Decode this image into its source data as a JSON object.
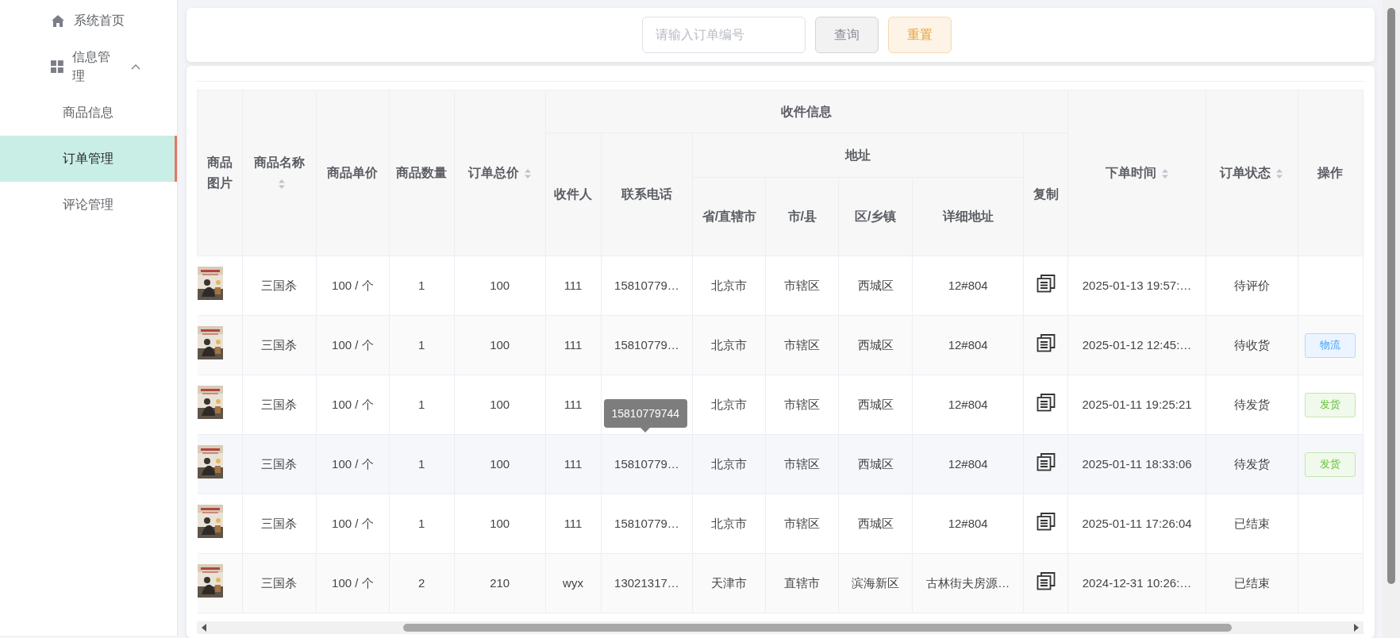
{
  "sidebar": {
    "items": [
      {
        "label": "系统首页",
        "selected": false
      },
      {
        "label": "信息管理",
        "expanded": true,
        "children": [
          {
            "label": "商品信息",
            "selected": false
          },
          {
            "label": "订单管理",
            "selected": true
          },
          {
            "label": "评论管理",
            "selected": false
          }
        ]
      }
    ]
  },
  "search": {
    "placeholder": "请输入订单编号",
    "buttons": [
      {
        "label": "查询",
        "kind": "default"
      },
      {
        "label": "重置",
        "kind": "warning"
      }
    ]
  },
  "table": {
    "columns": [
      {
        "label": "商品图片"
      },
      {
        "label": "商品名称",
        "sortable": true
      },
      {
        "label": "商品单价"
      },
      {
        "label": "商品数量"
      },
      {
        "label": "订单总价",
        "sortable": true
      },
      {
        "label": "收件信息",
        "colspan": 7,
        "children": [
          {
            "label": "收件人"
          },
          {
            "label": "联系电话"
          },
          {
            "label": "地址",
            "colspan": 4,
            "children": [
              {
                "label": "省/直辖市"
              },
              {
                "label": "市/县"
              },
              {
                "label": "区/乡镇"
              },
              {
                "label": "详细地址"
              }
            ]
          },
          {
            "label": "复制"
          }
        ]
      },
      {
        "label": "下单时间",
        "sortable": true
      },
      {
        "label": "订单状态",
        "sortable": true
      },
      {
        "label": "操作"
      }
    ],
    "rows": [
      {
        "cells": [
          {
            "kind": "picture"
          },
          {
            "kind": "text",
            "text": "三国杀"
          },
          {
            "kind": "text",
            "text": "100 / 个"
          },
          {
            "kind": "text",
            "text": "1"
          },
          {
            "kind": "text",
            "text": "100"
          },
          {
            "kind": "text",
            "text": "111"
          },
          {
            "kind": "text",
            "text": "15810779…"
          },
          {
            "kind": "text",
            "text": "北京市"
          },
          {
            "kind": "text",
            "text": "市辖区"
          },
          {
            "kind": "text",
            "text": "西城区"
          },
          {
            "kind": "text",
            "text": "12#804"
          },
          {
            "kind": "copy"
          },
          {
            "kind": "text",
            "text": "2025-01-13 19:57:…"
          },
          {
            "kind": "text",
            "text": "待评价"
          }
        ]
      },
      {
        "cells": [
          {
            "kind": "picture"
          },
          {
            "kind": "text",
            "text": "三国杀"
          },
          {
            "kind": "text",
            "text": "100 / 个"
          },
          {
            "kind": "text",
            "text": "1"
          },
          {
            "kind": "text",
            "text": "100"
          },
          {
            "kind": "text",
            "text": "111"
          },
          {
            "kind": "text",
            "text": "15810779…"
          },
          {
            "kind": "text",
            "text": "北京市"
          },
          {
            "kind": "text",
            "text": "市辖区"
          },
          {
            "kind": "text",
            "text": "西城区"
          },
          {
            "kind": "text",
            "text": "12#804"
          },
          {
            "kind": "copy"
          },
          {
            "kind": "text",
            "text": "2025-01-12 12:45:…"
          },
          {
            "kind": "text",
            "text": "待收货"
          },
          {
            "kind": "primary",
            "label": "物流"
          }
        ]
      },
      {
        "cells": [
          {
            "kind": "picture"
          },
          {
            "kind": "text",
            "text": "三国杀"
          },
          {
            "kind": "text",
            "text": "100 / 个"
          },
          {
            "kind": "text",
            "text": "1"
          },
          {
            "kind": "text",
            "text": "100"
          },
          {
            "kind": "text",
            "text": "111"
          },
          {
            "kind": "tooltip",
            "tooltip": "15810779744"
          },
          {
            "kind": "text",
            "text": "北京市"
          },
          {
            "kind": "text",
            "text": "市辖区"
          },
          {
            "kind": "text",
            "text": "西城区"
          },
          {
            "kind": "text",
            "text": "12#804"
          },
          {
            "kind": "copy"
          },
          {
            "kind": "text",
            "text": "2025-01-11 19:25:21"
          },
          {
            "kind": "text",
            "text": "待发货"
          },
          {
            "kind": "success",
            "label": "发货"
          }
        ]
      },
      {
        "cells": [
          {
            "kind": "picture"
          },
          {
            "kind": "text",
            "text": "三国杀"
          },
          {
            "kind": "text",
            "text": "100 / 个"
          },
          {
            "kind": "text",
            "text": "1"
          },
          {
            "kind": "text",
            "text": "100"
          },
          {
            "kind": "text",
            "text": "111"
          },
          {
            "kind": "text",
            "text": "15810779…"
          },
          {
            "kind": "text",
            "text": "北京市"
          },
          {
            "kind": "text",
            "text": "市辖区"
          },
          {
            "kind": "text",
            "text": "西城区"
          },
          {
            "kind": "text",
            "text": "12#804"
          },
          {
            "kind": "copy"
          },
          {
            "kind": "text",
            "text": "2025-01-11 18:33:06"
          },
          {
            "kind": "text",
            "text": "待发货"
          },
          {
            "kind": "success",
            "label": "发货"
          }
        ]
      },
      {
        "cells": [
          {
            "kind": "picture"
          },
          {
            "kind": "text",
            "text": "三国杀"
          },
          {
            "kind": "text",
            "text": "100 / 个"
          },
          {
            "kind": "text",
            "text": "1"
          },
          {
            "kind": "text",
            "text": "100"
          },
          {
            "kind": "text",
            "text": "111"
          },
          {
            "kind": "text",
            "text": "15810779…"
          },
          {
            "kind": "text",
            "text": "北京市"
          },
          {
            "kind": "text",
            "text": "市辖区"
          },
          {
            "kind": "text",
            "text": "西城区"
          },
          {
            "kind": "text",
            "text": "12#804"
          },
          {
            "kind": "copy"
          },
          {
            "kind": "text",
            "text": "2025-01-11 17:26:04"
          },
          {
            "kind": "text",
            "text": "已结束"
          }
        ]
      },
      {
        "cells": [
          {
            "kind": "picture"
          },
          {
            "kind": "text",
            "text": "三国杀"
          },
          {
            "kind": "text",
            "text": "100 / 个"
          },
          {
            "kind": "text",
            "text": "2"
          },
          {
            "kind": "text",
            "text": "210"
          },
          {
            "kind": "text",
            "text": "wyx"
          },
          {
            "kind": "text",
            "text": "13021317…"
          },
          {
            "kind": "text",
            "text": "天津市"
          },
          {
            "kind": "text",
            "text": "直辖市"
          },
          {
            "kind": "text",
            "text": "滨海新区"
          },
          {
            "kind": "text",
            "text": "古林街夫房源…"
          },
          {
            "kind": "copy"
          },
          {
            "kind": "text",
            "text": "2024-12-31 10:26:…"
          },
          {
            "kind": "text",
            "text": "已结束"
          }
        ]
      }
    ]
  }
}
